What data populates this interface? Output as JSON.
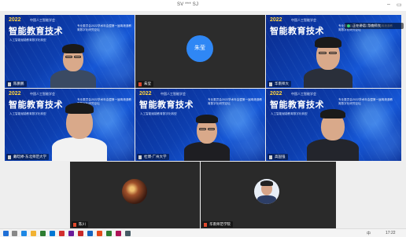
{
  "window": {
    "title": "SV *** SJ",
    "minimize": "–",
    "restore": "▭"
  },
  "banner": {
    "year": "2022",
    "org": "中国人工智能学会",
    "main": "智能教育技术",
    "side": "专业委员会2022学术年会暨第一届粤港澳教育数字化研究论坛",
    "sub": "人工智能赋能教育数字化转型"
  },
  "participants": [
    {
      "name": "陈鹏鹏",
      "kind": "video"
    },
    {
      "name": "朱莹",
      "kind": "avatar",
      "avatar_letter": "朱莹"
    },
    {
      "name": "华南师大",
      "kind": "video"
    },
    {
      "name": "戴晗婷-东北师范大学",
      "kind": "video"
    },
    {
      "name": "杜博-广州大学",
      "kind": "video"
    },
    {
      "name": "高国强",
      "kind": "video"
    },
    {
      "name": "陈川",
      "kind": "photo"
    },
    {
      "name": "华南师范学院",
      "kind": "photo"
    }
  ],
  "speaking_indicator": "正在讲话: 华南师大",
  "taskbar": {
    "clock": "17:22",
    "lang": "中"
  },
  "colors": {
    "banner_blue": "#0d3fb0",
    "avatar_blue": "#2f87f5",
    "year_yellow": "#ffd23f"
  }
}
